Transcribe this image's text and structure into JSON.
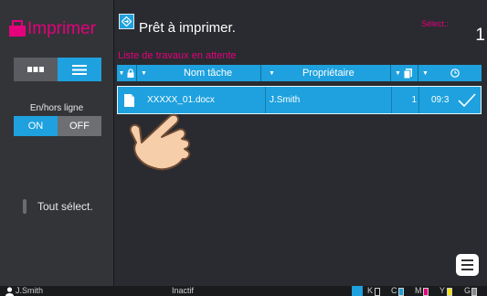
{
  "app": {
    "title": "Imprimer"
  },
  "sidebar": {
    "view_modes": [
      "grid-view",
      "list-view"
    ],
    "active_view": "list-view",
    "online_label": "En/hors ligne",
    "online_on": "ON",
    "online_off": "OFF",
    "online_state": "ON",
    "select_all": "Tout sélect."
  },
  "status": {
    "message": "Prêt à imprimer.",
    "select_label": "Sélect.:",
    "select_count": "1"
  },
  "job_list": {
    "title": "Liste de travaux en attente",
    "columns": {
      "name": "Nom tâche",
      "owner": "Propriétaire"
    },
    "rows": [
      {
        "name": "XXXXX_01.docx",
        "owner": "J.Smith",
        "copies": "1",
        "time": "09:3"
      }
    ]
  },
  "status_bar": {
    "user": "J.Smith",
    "state": "Inactif",
    "toner": [
      {
        "label": "K",
        "color": "#111111"
      },
      {
        "label": "C",
        "color": "#1ea1de"
      },
      {
        "label": "M",
        "color": "#e5007d"
      },
      {
        "label": "Y",
        "color": "#f3e500"
      },
      {
        "label": "G",
        "color": "#8a8a8a"
      }
    ]
  },
  "colors": {
    "accent": "#1ea1de",
    "brand": "#e5007d",
    "background": "#2a2b30"
  }
}
